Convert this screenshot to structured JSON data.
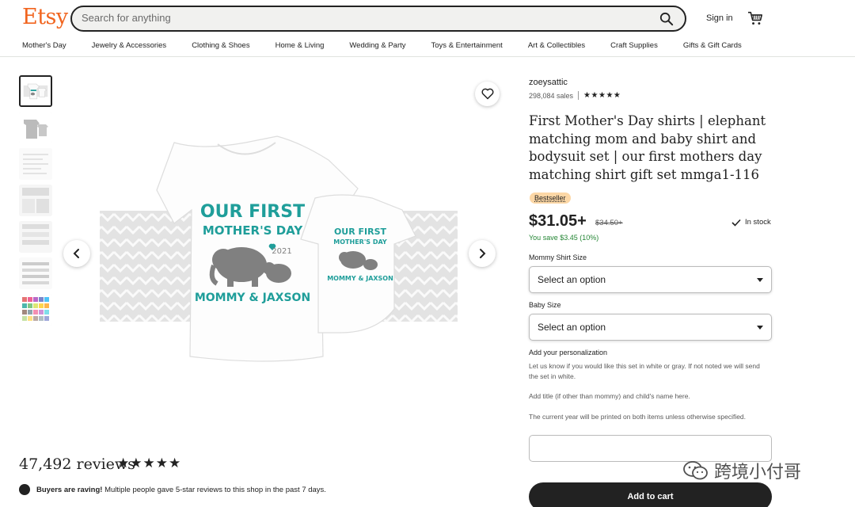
{
  "header": {
    "logo": "Etsy",
    "search_placeholder": "Search for anything",
    "sign_in": "Sign in",
    "nav": [
      "Mother's Day",
      "Jewelry & Accessories",
      "Clothing & Shoes",
      "Home & Living",
      "Wedding & Party",
      "Toys & Entertainment",
      "Art & Collectibles",
      "Craft Supplies",
      "Gifts & Gift Cards"
    ]
  },
  "product": {
    "image_text": {
      "adult_line1": "OUR FIRST",
      "adult_line2": "MOTHER'S DAY",
      "year": "2021",
      "names": "MOMMY & JAXSON",
      "baby_line1": "OUR FIRST",
      "baby_line2": "MOTHER'S DAY",
      "baby_names": "MOMMY & JAXSON"
    },
    "review_count": "47,492 reviews",
    "stars": "★★★★★",
    "raving_bold": "Buyers are raving!",
    "raving_text": " Multiple people gave 5-star reviews to this shop in the past 7 days."
  },
  "listing": {
    "shop_name": "zoeysattic",
    "sales": "298,084 sales",
    "stars": "★★★★★",
    "title": "First Mother's Day shirts | elephant matching mom and baby shirt and bodysuit set | our first mothers day matching shirt gift set mmga1-116",
    "badge": "Bestseller",
    "price": "$31.05+",
    "old_price": "$34.50+",
    "in_stock": "In stock",
    "you_save": "You save $3.45 (10%)",
    "option1_label": "Mommy Shirt Size",
    "option1_value": "Select an option",
    "option2_label": "Baby Size",
    "option2_value": "Select an option",
    "personalization_label": "Add your personalization",
    "help1": "Let us know if you would like this set in white or gray. If not noted we will send the set in white.",
    "help2": "Add title (if other than mommy) and child's name here.",
    "help3": "The current year will be printed on both items unless otherwise specified.",
    "add_to_cart": "Add to cart",
    "watermark": "跨境小付哥"
  },
  "colors": {
    "brand": "#f1641e",
    "teal": "#1f9e9a",
    "elephant": "#808080",
    "save_green": "#258635",
    "badge_bg": "#fcd7a6"
  }
}
